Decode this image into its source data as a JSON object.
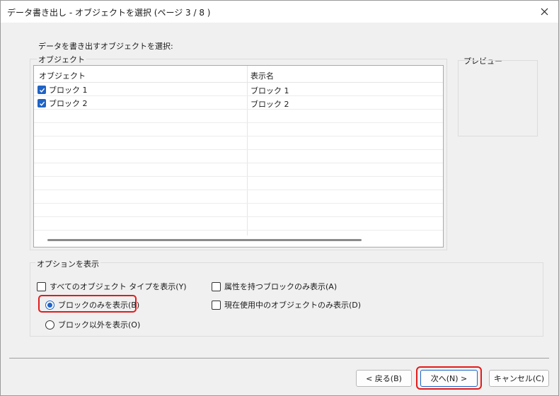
{
  "window": {
    "title": "データ書き出し - オブジェクトを選択 (ページ 3 / 8 )"
  },
  "instruction": "データを書き出すオブジェクトを選択:",
  "objects_group": {
    "label": "オブジェクト",
    "columns": [
      "オブジェクト",
      "表示名"
    ],
    "rows": [
      {
        "name": "ブロック 1",
        "display": "ブロック 1",
        "checked": true
      },
      {
        "name": "ブロック 2",
        "display": "ブロック 2",
        "checked": true
      }
    ]
  },
  "preview": {
    "label": "プレビュー"
  },
  "options_group": {
    "label": "オプションを表示",
    "show_all_types": "すべてのオブジェクト タイプを表示(Y)",
    "blocks_only": "ブロックのみを表示(B)",
    "non_blocks": "ブロック以外を表示(O)",
    "attr_blocks_only": "属性を持つブロックのみ表示(A)",
    "in_use_only": "現在使用中のオブジェクトのみ表示(D)"
  },
  "buttons": {
    "back": "< 戻る(B)",
    "next": "次へ(N) >",
    "cancel": "キャンセル(C)"
  },
  "colors": {
    "accent": "#1f63c5",
    "highlight": "#e31b1b"
  }
}
